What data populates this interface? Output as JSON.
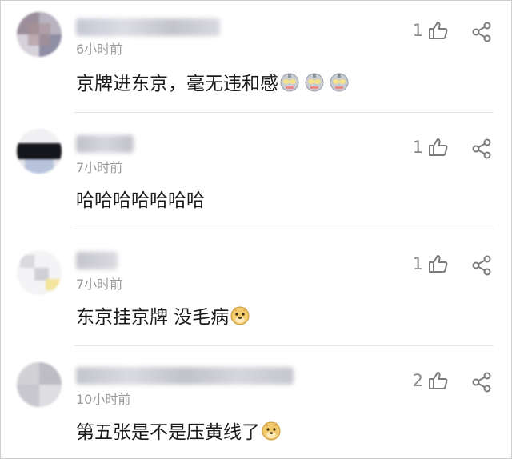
{
  "comments": [
    {
      "time": "6小时前",
      "text": "京牌进东京，毫无违和感",
      "emoji": "ultraman-face-emoji",
      "emoji_count": 3,
      "likes": "1"
    },
    {
      "time": "7小时前",
      "text": "哈哈哈哈哈哈哈",
      "likes": "1"
    },
    {
      "time": "7小时前",
      "text": "东京挂京牌 没毛病",
      "emoji": "doge-emoji",
      "emoji_count": 1,
      "likes": "1"
    },
    {
      "time": "10小时前",
      "text": "第五张是不是压黄线了",
      "emoji": "doge-emoji",
      "emoji_count": 1,
      "likes": "2"
    }
  ],
  "icons": {
    "like": "thumbs-up-icon",
    "share": "share-icon"
  },
  "colors": {
    "time": "#9a9a9a",
    "text": "#1a1a1a",
    "icon": "#7a7a7a",
    "divider": "#e6e6e6"
  }
}
